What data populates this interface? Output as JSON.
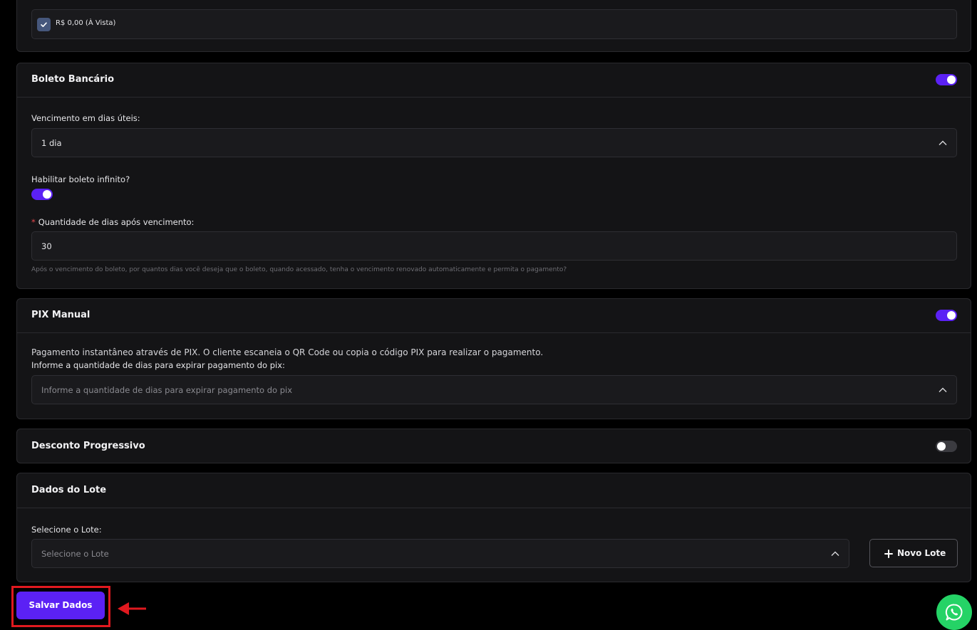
{
  "top_card": {
    "checkbox_label": "R$ 0,00 (À Vista)",
    "checked": true
  },
  "boleto": {
    "title": "Boleto Bancário",
    "enabled": true,
    "vencimento_label": "Vencimento em dias úteis:",
    "vencimento_value": "1 dia",
    "infinito_label": "Habilitar boleto infinito?",
    "infinito_enabled": true,
    "required_mark": "*",
    "quantidade_label": "Quantidade de dias após vencimento:",
    "quantidade_value": "30",
    "quantidade_help": "Após o vencimento do boleto, por quantos dias você deseja que o boleto, quando acessado, tenha o vencimento renovado automaticamente e permita o pagamento?"
  },
  "pix": {
    "title": "PIX Manual",
    "enabled": true,
    "description": "Pagamento instantâneo através de PIX. O cliente escaneia o QR Code ou copia o código PIX para realizar o pagamento.",
    "expira_label": "Informe a quantidade de dias para expirar pagamento do pix:",
    "expira_placeholder": "Informe a quantidade de dias para expirar pagamento do pix"
  },
  "desconto": {
    "title": "Desconto Progressivo",
    "enabled": false
  },
  "lote": {
    "title": "Dados do Lote",
    "select_label": "Selecione o Lote:",
    "select_placeholder": "Selecione o Lote",
    "new_button_label": "Novo Lote"
  },
  "footer": {
    "save_label": "Salvar Dados"
  },
  "colors": {
    "accent": "#5b21f5",
    "highlight": "#e0191f",
    "whatsapp": "#25d366"
  },
  "icons": {
    "checkbox": "check-icon",
    "select": "chevron-up-icon",
    "add": "plus-icon",
    "annotation": "arrow-left-icon",
    "chat": "whatsapp-icon"
  }
}
